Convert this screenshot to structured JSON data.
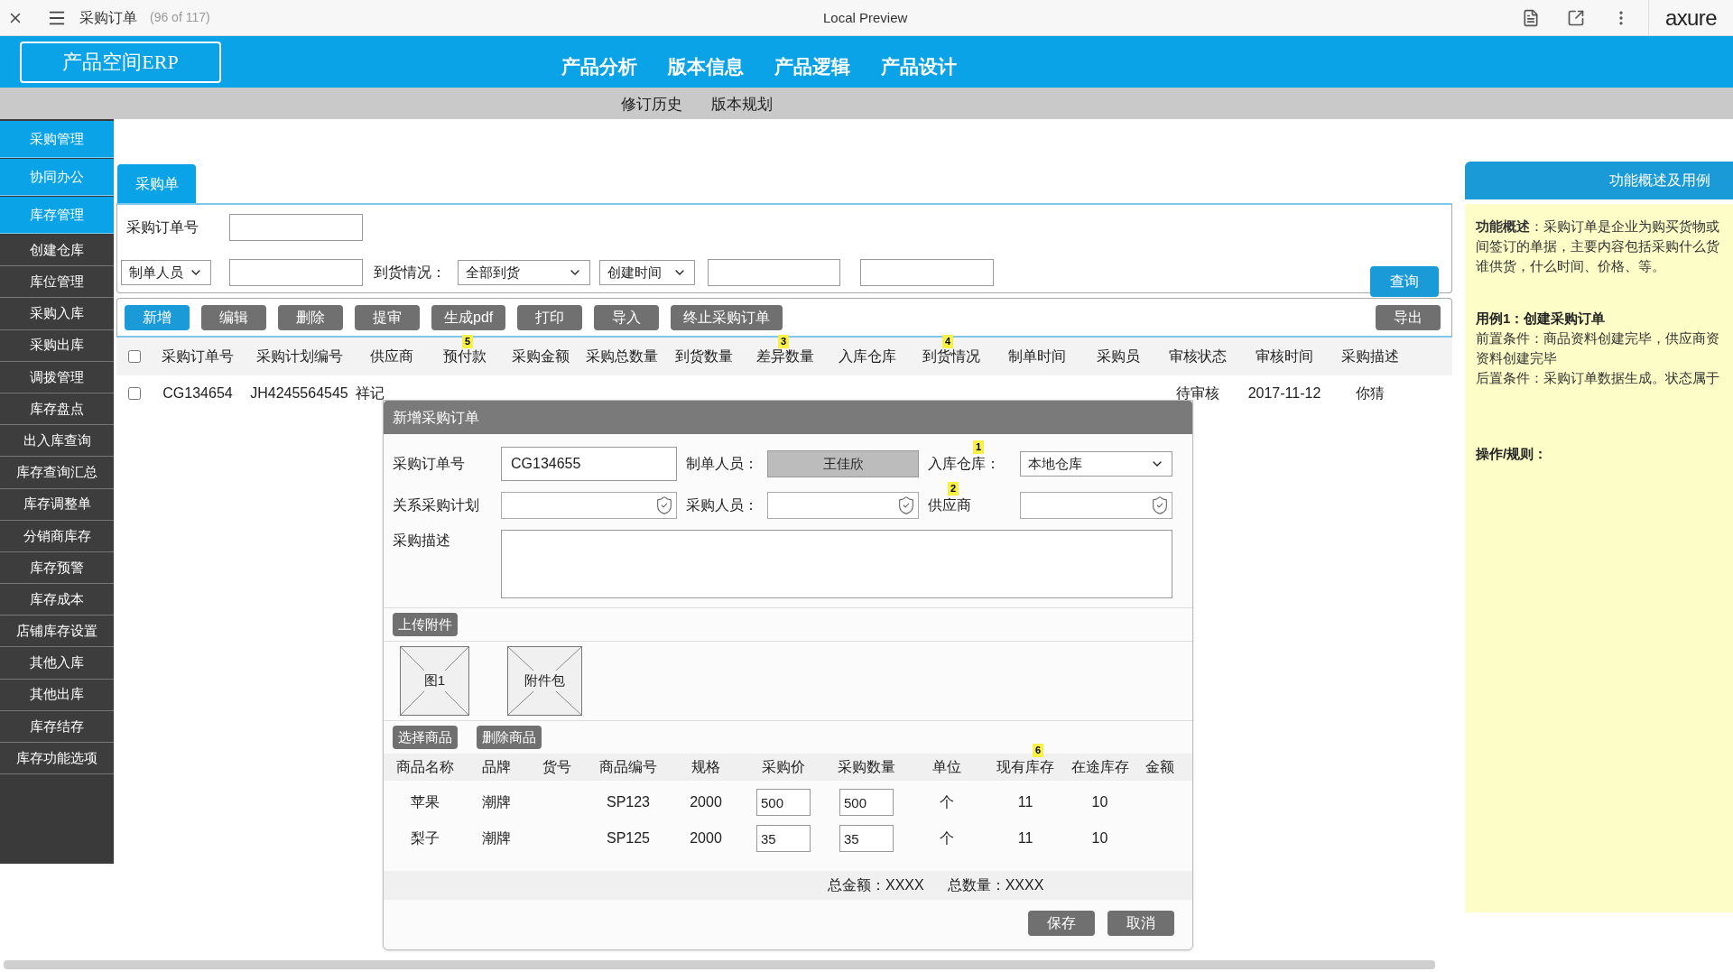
{
  "browser_bar": {
    "title": "采购订单",
    "page_count": "(96 of 117)",
    "center_title": "Local Preview",
    "brand": "axure"
  },
  "header": {
    "logo": "产品空间ERP",
    "nav": [
      "产品分析",
      "版本信息",
      "产品逻辑",
      "产品设计"
    ]
  },
  "subnav": [
    "修订历史",
    "版本规划"
  ],
  "sidebar": [
    {
      "label": "采购管理",
      "kind": "module"
    },
    {
      "label": "协同办公",
      "kind": "module"
    },
    {
      "label": "库存管理",
      "kind": "module"
    },
    {
      "label": "创建仓库",
      "kind": "item"
    },
    {
      "label": "库位管理",
      "kind": "item"
    },
    {
      "label": "采购入库",
      "kind": "item"
    },
    {
      "label": "采购出库",
      "kind": "item"
    },
    {
      "label": "调拨管理",
      "kind": "item"
    },
    {
      "label": "库存盘点",
      "kind": "item"
    },
    {
      "label": "出入库查询",
      "kind": "item"
    },
    {
      "label": "库存查询汇总",
      "kind": "item"
    },
    {
      "label": "库存调整单",
      "kind": "item"
    },
    {
      "label": "分销商库存",
      "kind": "item"
    },
    {
      "label": "库存预警",
      "kind": "item"
    },
    {
      "label": "库存成本",
      "kind": "item"
    },
    {
      "label": "店铺库存设置",
      "kind": "item"
    },
    {
      "label": "其他入库",
      "kind": "item"
    },
    {
      "label": "其他出库",
      "kind": "item"
    },
    {
      "label": "库存结存",
      "kind": "item"
    },
    {
      "label": "库存功能选项",
      "kind": "item"
    }
  ],
  "tab": {
    "label": "采购单",
    "selected": true
  },
  "filters": {
    "order_no_label": "采购订单号",
    "creator_select": "制单人员",
    "arrival_label": "到货情况：",
    "arrival_select": "全部到货",
    "time_select": "创建时间",
    "query_button": "查询"
  },
  "toolbar": {
    "buttons": [
      {
        "label": "新增",
        "kind": "primary"
      },
      {
        "label": "编辑",
        "kind": "default"
      },
      {
        "label": "删除",
        "kind": "default"
      },
      {
        "label": "提审",
        "kind": "default"
      },
      {
        "label": "生成pdf",
        "kind": "default"
      },
      {
        "label": "打印",
        "kind": "default"
      },
      {
        "label": "导入",
        "kind": "default"
      },
      {
        "label": "终止采购订单",
        "kind": "default"
      }
    ],
    "export_button": "导出"
  },
  "table": {
    "select_all_checked": false,
    "columns": [
      {
        "label": "采购订单号"
      },
      {
        "label": "采购计划编号"
      },
      {
        "label": "供应商"
      },
      {
        "label": "预付款",
        "note": "5"
      },
      {
        "label": "采购金额"
      },
      {
        "label": "采购总数量"
      },
      {
        "label": "到货数量"
      },
      {
        "label": "差异数量",
        "note": "3"
      },
      {
        "label": "入库仓库"
      },
      {
        "label": "到货情况",
        "note": "4"
      },
      {
        "label": "制单时间"
      },
      {
        "label": "采购员"
      },
      {
        "label": "审核状态"
      },
      {
        "label": "审核时间"
      },
      {
        "label": "采购描述"
      }
    ],
    "rows": [
      {
        "checked": false,
        "lead_cells": [
          "CG134654",
          "JH4245564545",
          "祥记"
        ],
        "tail_cells": [
          "待审核",
          "2017-11-12",
          "你猜"
        ]
      }
    ]
  },
  "dialog": {
    "title": "新增采购订单",
    "fields": [
      {
        "label": "采购订单号",
        "kind": "text",
        "value": "CG134655"
      },
      {
        "label": "制单人员：",
        "kind": "readonly",
        "value": "王佳欣"
      },
      {
        "label": "入库仓库：",
        "kind": "select",
        "value": "本地仓库",
        "note": "1"
      },
      {
        "label": "关系采购计划",
        "kind": "picker"
      },
      {
        "label": "采购人员：",
        "kind": "picker"
      },
      {
        "label": "供应商",
        "kind": "picker",
        "note": "2"
      },
      {
        "label": "采购描述",
        "kind": "textarea"
      }
    ],
    "upload_button": "上传附件",
    "attachments": [
      "图1",
      "附件包"
    ],
    "goods_buttons": [
      "选择商品",
      "删除商品"
    ],
    "goods_columns": [
      {
        "label": "商品名称"
      },
      {
        "label": "品牌"
      },
      {
        "label": "货号"
      },
      {
        "label": "商品编号"
      },
      {
        "label": "规格"
      },
      {
        "label": "采购价"
      },
      {
        "label": "采购数量"
      },
      {
        "label": "单位"
      },
      {
        "label": "现有库存",
        "note": "6"
      },
      {
        "label": "在途库存"
      },
      {
        "label": "金额"
      }
    ],
    "goods_rows": [
      {
        "name": "苹果",
        "brand": "潮牌",
        "code": "SP123",
        "spec": "2000",
        "price": "500",
        "qty": "500",
        "unit": "个",
        "stock": "11",
        "transit": "10"
      },
      {
        "name": "梨子",
        "brand": "潮牌",
        "code": "SP125",
        "spec": "2000",
        "price": "35",
        "qty": "35",
        "unit": "个",
        "stock": "11",
        "transit": "10"
      }
    ],
    "totals": [
      "总金额：XXXX",
      "总数量：XXXX"
    ],
    "buttons": [
      "保存",
      "取消"
    ]
  },
  "side_panel": {
    "title": "功能概述及用例",
    "lines": [
      {
        "kind": "text",
        "text": "**功能概述**：采购订单是企业为购买货物或"
      },
      {
        "kind": "text",
        "text": "间签订的单据，主要内容包括采购什么货"
      },
      {
        "kind": "text",
        "text": "谁供货，什么时间、价格、等。"
      },
      {
        "kind": "heading",
        "text": "用例1：创建采购订单"
      },
      {
        "kind": "text",
        "text": "前置条件：商品资料创建完毕，供应商资"
      },
      {
        "kind": "text",
        "text": "资料创建完毕"
      },
      {
        "kind": "text",
        "text": "后置条件：采购订单数据生成。状态属于"
      },
      {
        "kind": "heading",
        "text": "操作/规则："
      }
    ]
  }
}
